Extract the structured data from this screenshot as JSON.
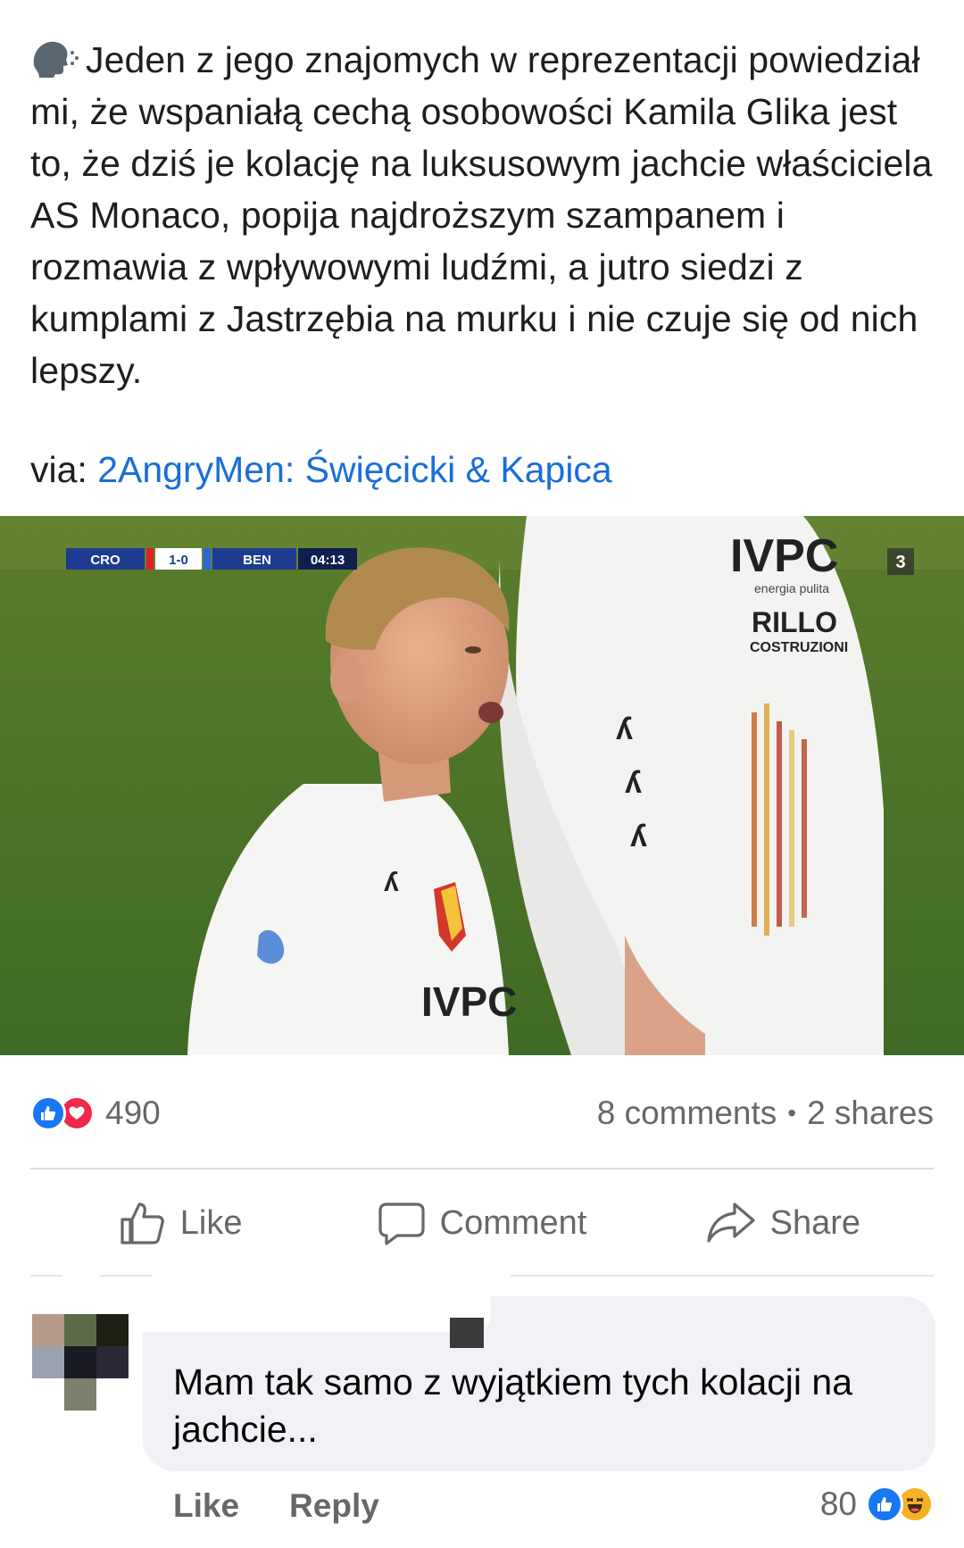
{
  "post": {
    "text": "Jeden z jego znajomych w reprezentacji powiedział mi, że wspaniałą cechą osobowości Kamila Glika jest to, że dziś je kolację na luksusowym jachcie właściciela AS Monaco, popija najdroższym szampanem i rozmawia z wpływowymi ludźmi, a jutro siedzi z kumplami z Jastrzębia na murku i nie czuje się od nich lepszy.",
    "via_prefix": "via: ",
    "via_link": "2AngryMen: Święcicki & Kapica",
    "lead_icon": "speaking-head-icon"
  },
  "media": {
    "scoreboard": {
      "home": "CRO",
      "score": "1-0",
      "away": "BEN",
      "time": "04:13"
    },
    "channel_tag": "3",
    "sponsor_text": "IVPC",
    "sponsor_sub": "energia pulita",
    "sleeve_text": "RILLO",
    "sleeve_sub": "COSTRUZIONI"
  },
  "stats": {
    "reaction_count": "490",
    "reaction_icons": [
      "like-icon",
      "love-icon"
    ],
    "comments": "8 comments",
    "separator": "•",
    "shares": "2 shares"
  },
  "actions": {
    "like": "Like",
    "comment": "Comment",
    "share": "Share"
  },
  "comment": {
    "text": "Mam tak samo z wyjątkiem tych kolacji na jachcie...",
    "like_label": "Like",
    "reply_label": "Reply",
    "reaction_count": "80",
    "reaction_icons": [
      "like-icon",
      "haha-icon"
    ]
  },
  "colors": {
    "link": "#1a6ed8",
    "like_blue": "#1877f2",
    "love_red": "#f0284a",
    "haha_yellow": "#f7b125",
    "muted": "#65676b",
    "bubble": "#f0f2f5"
  }
}
